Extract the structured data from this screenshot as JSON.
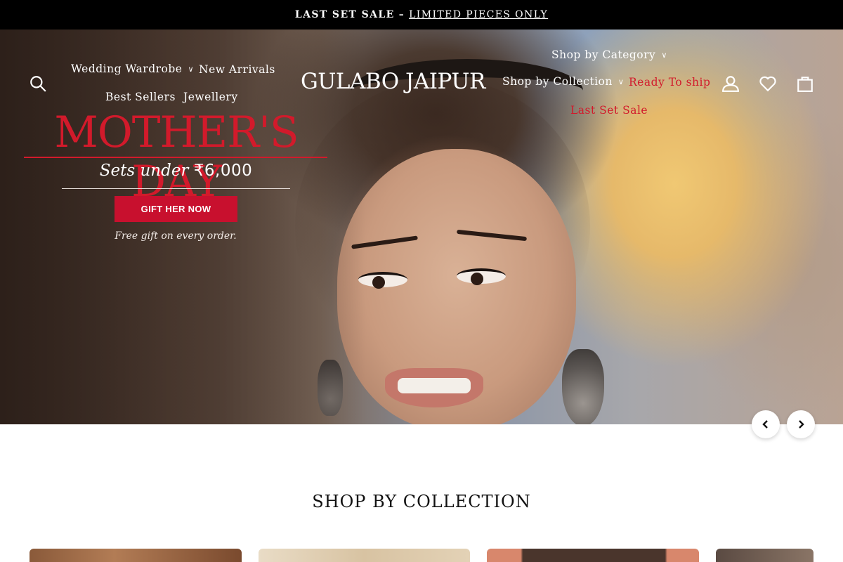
{
  "announcement": {
    "lead": "LAST SET SALE",
    "separator": "–",
    "link": "LIMITED PIECES ONLY"
  },
  "header": {
    "logo": "GULABO JAIPUR",
    "left_nav": [
      {
        "label": "Wedding Wardrobe",
        "dropdown": true
      },
      {
        "label": "New Arrivals",
        "dropdown": false
      },
      {
        "label": "Best Sellers",
        "dropdown": false
      },
      {
        "label": "Jewellery",
        "dropdown": false
      }
    ],
    "right_nav": [
      {
        "label": "Shop by Category",
        "dropdown": true
      },
      {
        "label": "Shop by Collection",
        "dropdown": true
      },
      {
        "label": "Ready To ship",
        "dropdown": false,
        "color": "#d21a2b"
      },
      {
        "label": "Last Set Sale",
        "dropdown": false,
        "color": "#d21a2b"
      }
    ],
    "icons": [
      "search-icon",
      "account-icon",
      "wishlist-heart-icon",
      "cart-bag-icon"
    ]
  },
  "hero": {
    "title": "MOTHER'S DAY",
    "subtitle_text": "Sets under",
    "subtitle_price": "₹6,000",
    "cta": "GIFT HER NOW",
    "note": "Free gift on every order.",
    "accent_color": "#d21a2b"
  },
  "carousel": {
    "prev_icon": "chevron-left-icon",
    "next_icon": "chevron-right-icon"
  },
  "section": {
    "title": "SHOP BY COLLECTION"
  }
}
